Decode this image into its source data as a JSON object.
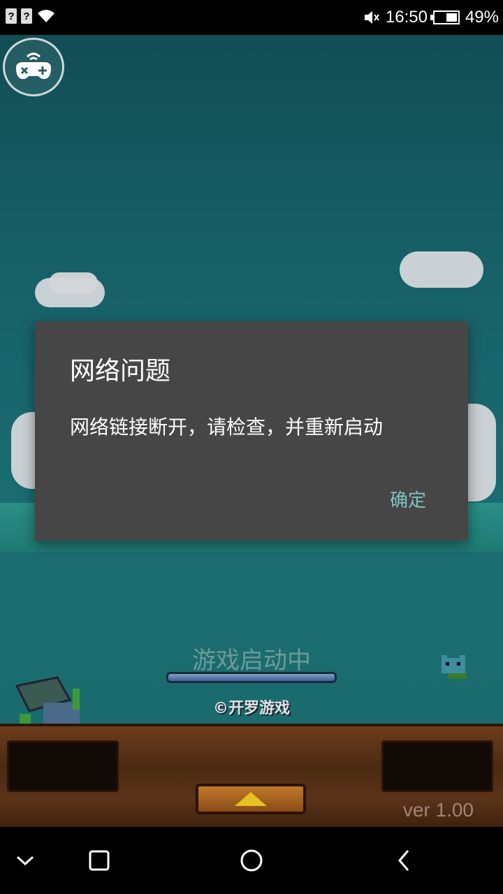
{
  "status_bar": {
    "sim1": "?",
    "sim2": "?",
    "time": "16:50",
    "battery_percent": "49%",
    "battery_level": 0.49
  },
  "game": {
    "loading_text": "游戏启动中",
    "copyright": "©开罗游戏",
    "version": "ver 1.00"
  },
  "dialog": {
    "title": "网络问题",
    "message": "网络链接断开，请检查，并重新启动",
    "ok_label": "确定"
  },
  "colors": {
    "dialog_bg": "#464646",
    "accent": "#7dc4c0"
  },
  "icons": [
    "gamepad-icon",
    "mute-icon",
    "wifi-icon",
    "battery-icon",
    "chevron-down-icon",
    "square-icon",
    "circle-icon",
    "back-icon"
  ]
}
